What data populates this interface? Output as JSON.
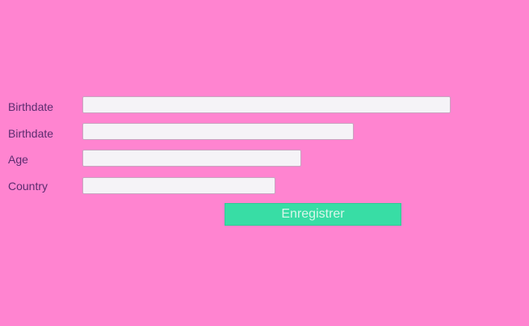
{
  "form": {
    "rows": [
      {
        "label": "Birthdate",
        "value": ""
      },
      {
        "label": "Birthdate",
        "value": ""
      },
      {
        "label": "Age",
        "value": ""
      },
      {
        "label": "Country",
        "value": ""
      }
    ],
    "submit_label": "Enregistrer"
  },
  "colors": {
    "background": "#ff84d0",
    "label_text": "#5b2c6f",
    "input_background": "#f5f3f7",
    "button_background": "#38dda5",
    "button_text": "#d7f6ea"
  }
}
